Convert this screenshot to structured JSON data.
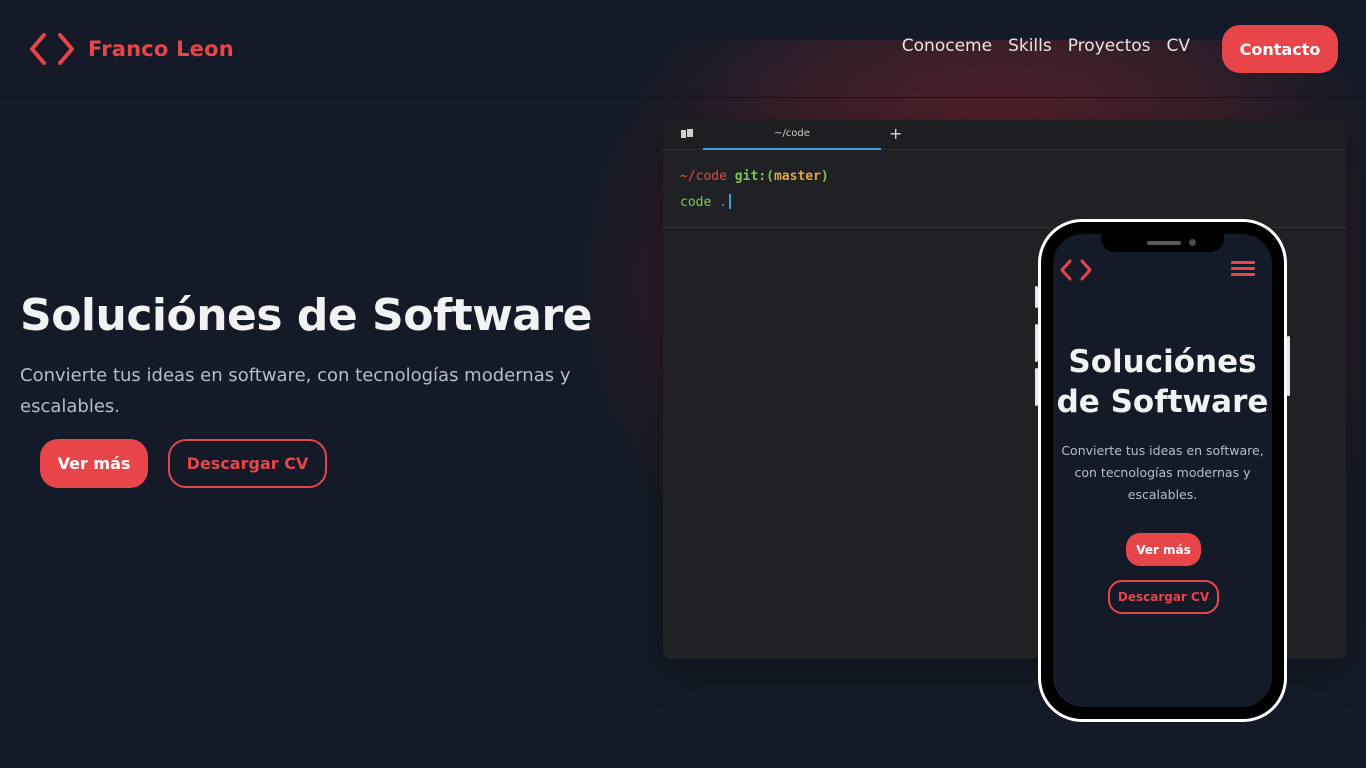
{
  "brand": {
    "name": "Franco Leon",
    "icon": "code-brackets-icon",
    "accent_color": "#e8454a",
    "background_color": "#141a27"
  },
  "nav": {
    "items": [
      "Conoceme",
      "Skills",
      "Proyectos",
      "CV"
    ],
    "contact_label": "Contacto"
  },
  "hero": {
    "title": "Soluciónes de Software",
    "subtitle": "Convierte tus ideas en software, con tecnologías modernas y escalables.",
    "primary_button": "Ver más",
    "secondary_button": "Descargar CV"
  },
  "terminal": {
    "tab_title": "~/code",
    "new_tab_icon": "plus-icon",
    "prompt_path": "~/code",
    "prompt_git": "git:(",
    "prompt_branch": "master",
    "prompt_close": ")",
    "command": "code",
    "command_arg": "."
  },
  "phone": {
    "menu_icon": "hamburger-menu-icon",
    "title": "Soluciónes de Software",
    "subtitle": "Convierte tus ideas en software, con tecnologías modernas y escalables.",
    "primary_button": "Ver más",
    "secondary_button": "Descargar CV"
  }
}
